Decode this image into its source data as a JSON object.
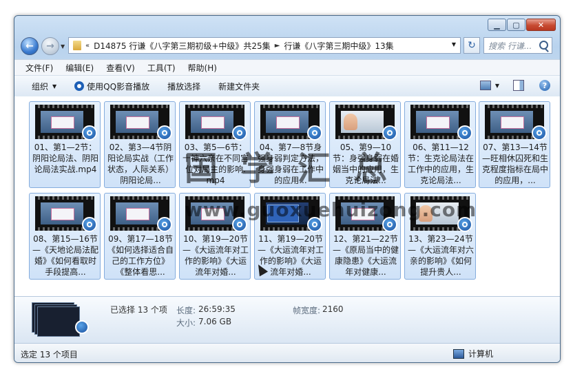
{
  "titlebar": {
    "minimize_icon": "minimize-icon",
    "maximize_icon": "maximize-icon",
    "close_icon": "close-icon"
  },
  "address": {
    "chevron": "«",
    "crumbs": [
      "D14875 行谦《八字第三期初级+中级》共25集",
      "行谦《八字第三期中级》13集"
    ],
    "search_placeholder": "搜索 行谦...",
    "refresh_symbol": "↻"
  },
  "menu": {
    "items": [
      "文件(F)",
      "编辑(E)",
      "查看(V)",
      "工具(T)",
      "帮助(H)"
    ]
  },
  "toolbar": {
    "organize": "组织",
    "play_qq": "使用QQ影音播放",
    "play_selection": "播放选择",
    "new_folder": "新建文件夹",
    "help_symbol": "?"
  },
  "files": [
    {
      "name": "01、第1—2节：阴阳论局法、阴阳论局法实战.mp4",
      "thumb": "slide"
    },
    {
      "name": "02、第3—4节阴阳论局实战（工作状态，人际关系）阴阳论局...",
      "thumb": "slide"
    },
    {
      "name": "03、第5—6节：十神六亲在不同宫位对局主的影响.mp4",
      "thumb": "slide"
    },
    {
      "name": "04、第7—8节身强身弱判定方法，身强身弱在工作中的应用...",
      "thumb": "slide"
    },
    {
      "name": "05、第9—10节：身强身弱在婚姻当中的应用，生克论局法...",
      "thumb": "person"
    },
    {
      "name": "06、第11—12节：生克论局法在工作中的应用，生克论局法...",
      "thumb": "slide"
    },
    {
      "name": "07、第13—14节—旺相休囚死和生克程度指标在局中的应用，...",
      "thumb": "slide"
    },
    {
      "name": "08、第15—16节—《天地论局法配婚》《如何看取时手段提高...",
      "thumb": "slide"
    },
    {
      "name": "09、第17—18节《如何选择适合自己的工作方位》《整体看思...",
      "thumb": "slide"
    },
    {
      "name": "10、第19—20节—《大运流年对工作的影响》《大运流年对婚...",
      "thumb": "slide"
    },
    {
      "name": "11、第19—20节—《大运流年对工作的影响》《大运流年对婚...",
      "thumb": "dark"
    },
    {
      "name": "12、第21—22节—《原局当中的健康隐患》《大运流年对健康...",
      "thumb": "slide"
    },
    {
      "name": "13、第23—24节—《大运流年对六亲的影响》《如何提升贵人...",
      "thumb": "person"
    }
  ],
  "details": {
    "selected": "已选择 13 个项",
    "length_key": "长度:",
    "length_val": "26:59:35",
    "size_key": "大小:",
    "size_val": "7.06 GB",
    "framewidth_key": "帧宽度:",
    "framewidth_val": "2160"
  },
  "status": {
    "left": "选定 13 个项目",
    "right": "计算机"
  },
  "watermark": {
    "cn": "国学汇总",
    "url": "www.guoxuehuizong.com"
  }
}
